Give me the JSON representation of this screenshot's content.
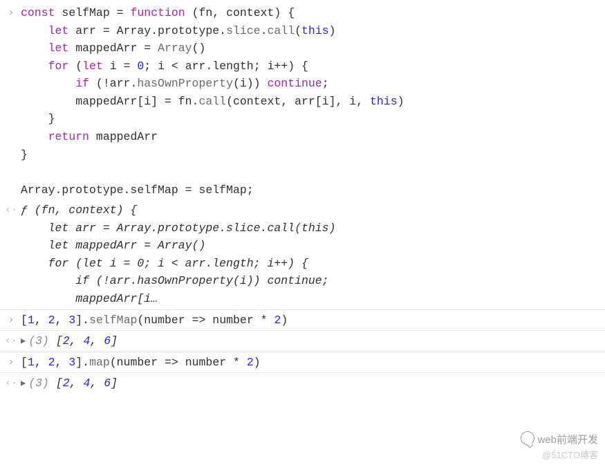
{
  "rows": [
    {
      "gutter": "›",
      "type": "input",
      "code_lines": [
        [
          [
            "kw",
            "const"
          ],
          [
            "op",
            " selfMap "
          ],
          [
            "op",
            "= "
          ],
          [
            "kw",
            "function"
          ],
          [
            "pun",
            " (fn, context) {"
          ]
        ],
        [
          [
            "pun",
            "    "
          ],
          [
            "kw",
            "let"
          ],
          [
            "pun",
            " arr = Array.prototype."
          ],
          [
            "call",
            "slice"
          ],
          [
            "pun",
            "."
          ],
          [
            "call",
            "call"
          ],
          [
            "pun",
            "("
          ],
          [
            "num",
            "this"
          ],
          [
            "pun",
            ")"
          ]
        ],
        [
          [
            "pun",
            "    "
          ],
          [
            "kw",
            "let"
          ],
          [
            "pun",
            " mappedArr = "
          ],
          [
            "call",
            "Array"
          ],
          [
            "pun",
            "()"
          ]
        ],
        [
          [
            "pun",
            "    "
          ],
          [
            "kw",
            "for"
          ],
          [
            "pun",
            " ("
          ],
          [
            "kw",
            "let"
          ],
          [
            "pun",
            " i = "
          ],
          [
            "num",
            "0"
          ],
          [
            "pun",
            "; i < arr.length; i++) {"
          ]
        ],
        [
          [
            "pun",
            "        "
          ],
          [
            "kw",
            "if"
          ],
          [
            "pun",
            " (!arr."
          ],
          [
            "call",
            "hasOwnProperty"
          ],
          [
            "pun",
            "(i)) "
          ],
          [
            "kw",
            "continue"
          ],
          [
            "pun",
            ";"
          ]
        ],
        [
          [
            "pun",
            "        mappedArr[i] = fn."
          ],
          [
            "call",
            "call"
          ],
          [
            "pun",
            "(context, arr[i], i, "
          ],
          [
            "num",
            "this"
          ],
          [
            "pun",
            ")"
          ]
        ],
        [
          [
            "pun",
            "    }"
          ]
        ],
        [
          [
            "pun",
            "    "
          ],
          [
            "kw",
            "return"
          ],
          [
            "pun",
            " mappedArr"
          ]
        ],
        [
          [
            "pun",
            "}"
          ]
        ],
        [
          [
            "pun",
            ""
          ]
        ],
        [
          [
            "pun",
            "Array.prototype.selfMap = selfMap;"
          ]
        ]
      ]
    },
    {
      "gutter": "‹·",
      "type": "output",
      "italic": true,
      "code_lines": [
        [
          [
            "pun",
            "ƒ (fn, context) {"
          ]
        ],
        [
          [
            "pun",
            "    let arr = Array.prototype.slice.call(this)"
          ]
        ],
        [
          [
            "pun",
            "    let mappedArr = Array()"
          ]
        ],
        [
          [
            "pun",
            "    for (let i = 0; i < arr.length; i++) {"
          ]
        ],
        [
          [
            "pun",
            "        if (!arr.hasOwnProperty(i)) continue;"
          ]
        ],
        [
          [
            "pun",
            "        mappedArr[i…"
          ]
        ]
      ]
    },
    {
      "gutter": "›",
      "type": "input",
      "divider": true,
      "code_lines": [
        [
          [
            "pun",
            "["
          ],
          [
            "num",
            "1"
          ],
          [
            "pun",
            ", "
          ],
          [
            "num",
            "2"
          ],
          [
            "pun",
            ", "
          ],
          [
            "num",
            "3"
          ],
          [
            "pun",
            "]."
          ],
          [
            "call",
            "selfMap"
          ],
          [
            "pun",
            "(number "
          ],
          [
            "op",
            "=>"
          ],
          [
            "pun",
            " number * "
          ],
          [
            "num",
            "2"
          ],
          [
            "pun",
            ")"
          ]
        ]
      ]
    },
    {
      "gutter": "‹·",
      "type": "output",
      "italic": true,
      "divider": true,
      "expandable": true,
      "code_lines": [
        [
          [
            "len",
            "(3) "
          ],
          [
            "pun",
            "["
          ],
          [
            "num",
            "2"
          ],
          [
            "pun",
            ", "
          ],
          [
            "num",
            "4"
          ],
          [
            "pun",
            ", "
          ],
          [
            "num",
            "6"
          ],
          [
            "pun",
            "]"
          ]
        ]
      ]
    },
    {
      "gutter": "›",
      "type": "input",
      "divider": true,
      "code_lines": [
        [
          [
            "pun",
            "["
          ],
          [
            "num",
            "1"
          ],
          [
            "pun",
            ", "
          ],
          [
            "num",
            "2"
          ],
          [
            "pun",
            ", "
          ],
          [
            "num",
            "3"
          ],
          [
            "pun",
            "]."
          ],
          [
            "call",
            "map"
          ],
          [
            "pun",
            "(number "
          ],
          [
            "op",
            "=>"
          ],
          [
            "pun",
            " number * "
          ],
          [
            "num",
            "2"
          ],
          [
            "pun",
            ")"
          ]
        ]
      ]
    },
    {
      "gutter": "‹·",
      "type": "output",
      "italic": true,
      "divider": true,
      "expandable": true,
      "code_lines": [
        [
          [
            "len",
            "(3) "
          ],
          [
            "pun",
            "["
          ],
          [
            "num",
            "2"
          ],
          [
            "pun",
            ", "
          ],
          [
            "num",
            "4"
          ],
          [
            "pun",
            ", "
          ],
          [
            "num",
            "6"
          ],
          [
            "pun",
            "]"
          ]
        ]
      ]
    }
  ],
  "watermark1": "web前端开发",
  "watermark2": "@51CTO博客"
}
